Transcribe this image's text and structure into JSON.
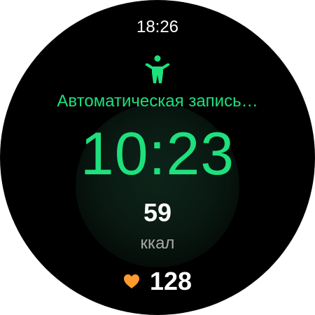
{
  "status": {
    "time": "18:26"
  },
  "workout": {
    "icon": "standing-person-icon",
    "title": "Автоматическая запись…",
    "duration": "10:23",
    "accent_color": "#1ee07d"
  },
  "calories": {
    "value": "59",
    "unit": "ккал"
  },
  "heart_rate": {
    "icon": "heart-icon",
    "value": "128",
    "icon_color": "#ff9a2e"
  }
}
